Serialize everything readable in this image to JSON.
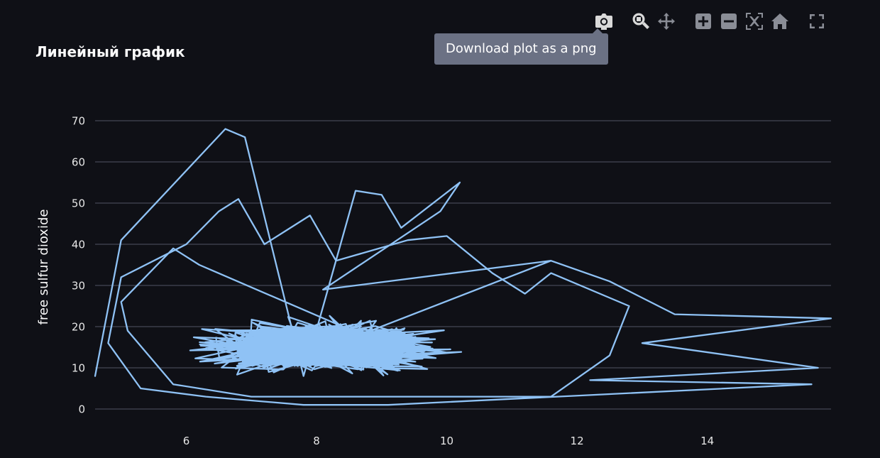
{
  "page": {
    "background": "#0f1016"
  },
  "modebar": {
    "buttons": [
      {
        "name": "camera-icon",
        "active": true
      },
      {
        "name": "zoom-icon",
        "active": true
      },
      {
        "name": "pan-icon",
        "active": false
      },
      {
        "name": "zoom-in-icon",
        "active": false
      },
      {
        "name": "zoom-out-icon",
        "active": false
      },
      {
        "name": "autoscale-icon",
        "active": false
      },
      {
        "name": "home-icon",
        "active": false
      },
      {
        "name": "fullscreen-icon",
        "active": false
      }
    ],
    "icon_color": "#8a8d96",
    "active_icon_color": "#d9d9d9"
  },
  "tooltip": {
    "text": "Download plot as a png"
  },
  "chart_data": {
    "type": "line",
    "title": "Линейный график",
    "xlabel": "",
    "ylabel": "free sulfur dioxide",
    "xlim": [
      4.6,
      15.9
    ],
    "ylim": [
      0,
      70
    ],
    "x_ticks": [
      6,
      8,
      10,
      12,
      14
    ],
    "y_ticks": [
      0,
      10,
      20,
      30,
      40,
      50,
      60,
      70
    ],
    "grid": true,
    "line_color": "#8fc2f5",
    "series": [
      {
        "name": "",
        "anchors": [
          [
            4.6,
            8
          ],
          [
            5.0,
            41
          ],
          [
            6.6,
            68
          ],
          [
            6.9,
            66
          ],
          [
            7.8,
            8
          ],
          [
            8.6,
            53
          ],
          [
            9.0,
            52
          ],
          [
            9.3,
            44
          ],
          [
            10.2,
            55
          ],
          [
            9.9,
            48
          ],
          [
            8.1,
            29
          ],
          [
            11.6,
            36
          ],
          [
            12.5,
            31
          ],
          [
            13.5,
            23
          ],
          [
            15.9,
            22
          ],
          [
            13.0,
            16
          ],
          [
            15.7,
            10
          ],
          [
            12.2,
            7
          ],
          [
            15.6,
            6
          ],
          [
            9.1,
            1
          ],
          [
            7.8,
            1
          ],
          [
            6.3,
            3
          ],
          [
            5.3,
            5
          ],
          [
            4.8,
            16
          ],
          [
            5.0,
            32
          ],
          [
            6.0,
            40
          ],
          [
            6.5,
            48
          ],
          [
            6.8,
            51
          ],
          [
            7.2,
            40
          ],
          [
            7.5,
            43
          ],
          [
            7.9,
            47
          ],
          [
            8.3,
            36
          ],
          [
            9.4,
            41
          ],
          [
            10.0,
            42
          ],
          [
            10.7,
            33
          ],
          [
            11.2,
            28
          ],
          [
            11.6,
            33
          ],
          [
            12.8,
            25
          ],
          [
            12.5,
            13
          ],
          [
            11.6,
            3
          ],
          [
            7.0,
            3
          ],
          [
            5.8,
            6
          ],
          [
            5.1,
            19
          ],
          [
            5.0,
            26
          ],
          [
            5.8,
            39
          ],
          [
            6.2,
            35
          ]
        ]
      }
    ]
  }
}
